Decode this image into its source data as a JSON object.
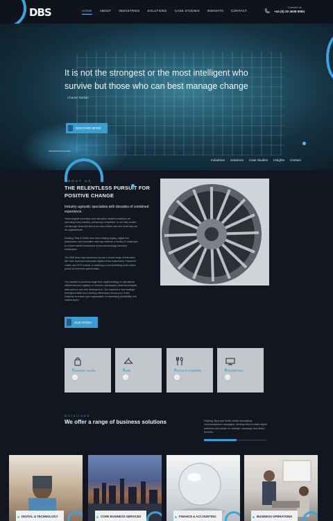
{
  "brand": {
    "logo_text": "DBS",
    "accent": "#3a9ccf"
  },
  "nav": {
    "items": [
      "HOME",
      "ABOUT",
      "INDUSTRIES",
      "SOLUTIONS",
      "CASE STUDIES",
      "INSIGHTS",
      "CONTACT"
    ],
    "active": "HOME"
  },
  "contact": {
    "label": "Contact Us",
    "phone": "+44 (0) 20 4638 8084"
  },
  "hero": {
    "quote": "It is not the strongest or the most intelligent who survive but those who can best manage change",
    "author": "Charles Darwin",
    "button": "DISCOVER MORE"
  },
  "subnav": [
    "Industries",
    "Solutions",
    "Case Studies",
    "Insights",
    "Contact"
  ],
  "about": {
    "eyebrow": "ABOUT US",
    "title": "THE RELENTLESS PURSUIT FOR POSITIVE CHANGE",
    "lead": "Industry agnostic specialists with decades of combined experience.",
    "paragraphs": [
      "Technological innovation and disruptive market conditions are upending every industry, pressuring companies, to not only scratch out stronger financial returns but also rethink who and what they are as organisations.",
      "Dowling, Best & Smith have been helping legacy, digital first businesses, and innovative start-ups address a variety of challenges to ensure market dominance across increasingly fractured landscapes.",
      "The DBS team has experience across a broad range of industries. We have launched successful digital media businesses, restaurant chains and CPG brands, to advising on and furthering multi-million pound eCommerce partnerships.",
      "Our breadth of solutions range from digital strategy to operational efficiencies and logistics, to revenue optimisation, financial analysis, data science and web development. Our experience and strategic foresight enable us to develop efficiencies across your entire business to ensure your organisation is maximising profitability and market share."
    ],
    "button": "OUR STORY"
  },
  "industries": [
    {
      "label": "Consumer Goods",
      "icon": "shopping-bag-icon"
    },
    {
      "label": "Retail",
      "icon": "hanger-icon"
    },
    {
      "label": "Food and Hospitality",
      "icon": "cutlery-icon"
    },
    {
      "label": "Entertainment",
      "icon": "screen-icon"
    }
  ],
  "solutions": {
    "eyebrow": "Solutions",
    "title": "We offer a range of business solutions",
    "description": "Dowling, Best and Smith create exceptional communications campaigns, develop best-in-class digital platforms and advise on strategic roadmaps that define success.",
    "progress": 0.52,
    "cards": [
      "DIGITAL & TECHNOLOGY",
      "CORE BUSINESS SERVICES",
      "FINANCE & ACCOUNTING",
      "BUSINESS OPERATIONS"
    ]
  }
}
